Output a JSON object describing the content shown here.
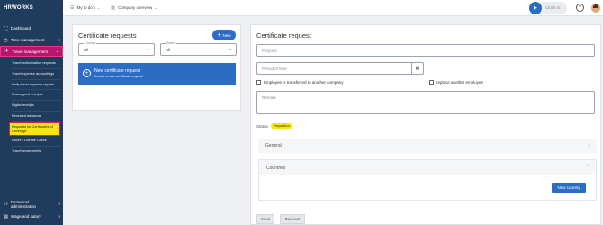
{
  "logo": {
    "text": "HRWORKS"
  },
  "sidebar": {
    "items": [
      {
        "label": "Dashboard",
        "icon": "dashboard-icon"
      },
      {
        "label": "Time management",
        "icon": "clock-icon",
        "chevron": "›"
      },
      {
        "label": "Travel management",
        "icon": "plane-icon",
        "chevron": "⌄"
      }
    ],
    "subitems": [
      "Travel authorisation requests",
      "Travel expense accountings",
      "Daily travel expense reports",
      "Unassigned receipts",
      "Digital receipts",
      "Received advances",
      "Requests for Certificates of Coverage",
      "Driver's License Check",
      "Travel amusements"
    ],
    "bottom": [
      {
        "label": "Personnel administration",
        "icon": "person-icon",
        "chevron": "›"
      },
      {
        "label": "Wage and salary",
        "icon": "money-icon",
        "chevron": "›"
      }
    ]
  },
  "topbar": {
    "todo_label": "My to do's",
    "company_label": "Company overview",
    "clock_label": "Clock in"
  },
  "left_panel": {
    "title": "Certificate requests",
    "new_label": "New",
    "country_label": "Country",
    "country_value": "All",
    "status_label": "Status",
    "status_value": "All",
    "card_title": "New certificate request",
    "card_subtitle": "Create a new certificate request"
  },
  "right_panel": {
    "title": "Certificate request",
    "purpose_placeholder": "Purpose",
    "period_placeholder": "Period of time",
    "cb_transferred": "Employee is transferred to another company",
    "cb_replace": "replace another employee",
    "remark_placeholder": "Remark",
    "status_label": "Status",
    "status_badge": "Preparation",
    "section_general": "General",
    "section_countries": "Countries",
    "new_country_label": "New country",
    "save_label": "Save",
    "request_label": "Request"
  },
  "colors": {
    "sidebar_bg": "#1f3c5d",
    "accent_blue": "#2b6cc4",
    "active_pink": "#b5176c",
    "highlight_yellow": "#f5e80a"
  }
}
